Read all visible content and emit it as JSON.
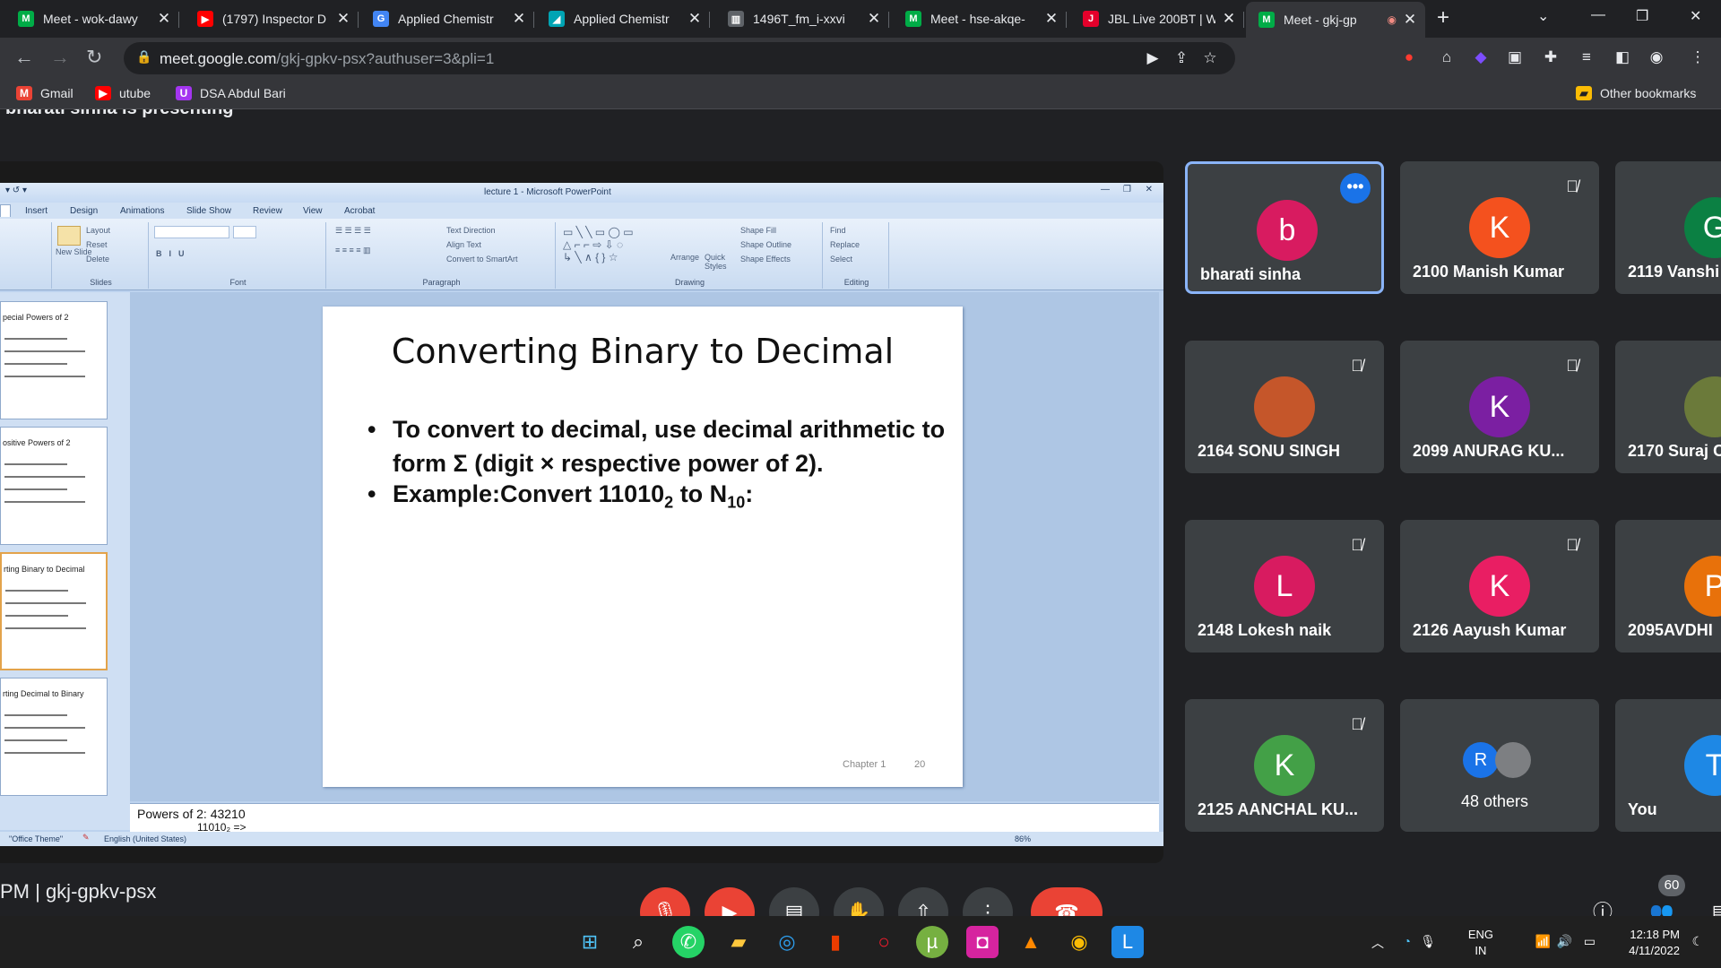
{
  "browser": {
    "tabs": [
      {
        "title": "Meet - wok-dawy",
        "fav_color": "#00ac47",
        "fav_glyph": "M",
        "active": false
      },
      {
        "title": "(1797) Inspector D",
        "fav_color": "#ff0000",
        "fav_glyph": "▶",
        "active": false
      },
      {
        "title": "Applied Chemistr",
        "fav_color": "#4285f4",
        "fav_glyph": "G",
        "active": false
      },
      {
        "title": "Applied Chemistr",
        "fav_color": "#00a4b4",
        "fav_glyph": "◢",
        "active": false
      },
      {
        "title": "1496T_fm_i-xxvi",
        "fav_color": "#5f6368",
        "fav_glyph": "▥",
        "active": false
      },
      {
        "title": "Meet - hse-akqe-",
        "fav_color": "#00ac47",
        "fav_glyph": "M",
        "active": false
      },
      {
        "title": "JBL Live 200BT | W",
        "fav_color": "#e4002b",
        "fav_glyph": "J",
        "active": false
      },
      {
        "title": "Meet - gkj-gp",
        "fav_color": "#00ac47",
        "fav_glyph": "M",
        "active": true
      }
    ],
    "url_host": "meet.google.com",
    "url_path": "/gkj-gpkv-psx?authuser=3&pli=1",
    "bookmarks": [
      {
        "label": "Gmail",
        "icon": "gmail-icon",
        "color": "#ea4335",
        "glyph": "M"
      },
      {
        "label": "utube",
        "icon": "youtube-icon",
        "color": "#ff0000",
        "glyph": "▶"
      },
      {
        "label": "DSA Abdul Bari",
        "icon": "udemy-icon",
        "color": "#a435f0",
        "glyph": "U"
      }
    ],
    "other_bookmarks": "Other bookmarks"
  },
  "meet": {
    "presenting_text": "bharati sinha is presenting",
    "participants": [
      {
        "name": "bharati sinha",
        "initial": "b",
        "color": "#d81b60",
        "muted": false,
        "active": true
      },
      {
        "name": "2100 Manish Kumar",
        "initial": "K",
        "color": "#f4511e",
        "muted": true
      },
      {
        "name": "2119 Vanshi",
        "initial": "G",
        "color": "#0b8043",
        "muted": false
      },
      {
        "name": "2164 SONU SINGH",
        "initial": "",
        "color": "#c5562a",
        "muted": true,
        "photo": true
      },
      {
        "name": "2099 ANURAG KU...",
        "initial": "K",
        "color": "#7b1fa2",
        "muted": true
      },
      {
        "name": "2170 Suraj C",
        "initial": "",
        "color": "#6b7a3a",
        "muted": false,
        "photo": true
      },
      {
        "name": "2148 Lokesh naik",
        "initial": "L",
        "color": "#d81b60",
        "muted": true
      },
      {
        "name": "2126 Aayush Kumar",
        "initial": "K",
        "color": "#e91e63",
        "muted": true
      },
      {
        "name": "2095AVDHI",
        "initial": "P",
        "color": "#e8710a",
        "muted": false
      },
      {
        "name": "2125 AANCHAL KU...",
        "initial": "K",
        "color": "#43a047",
        "muted": true
      },
      {
        "name": "48 others",
        "initial": "R",
        "color": "#1a73e8",
        "muted": false,
        "others": true
      },
      {
        "name": "You",
        "initial": "T",
        "color": "#1e88e5",
        "muted": false
      }
    ],
    "clock_text": "PM | gkj-gpkv-psx",
    "participant_count": "60"
  },
  "powerpoint": {
    "window_title": "lecture 1 - Microsoft PowerPoint",
    "tabs": [
      "Insert",
      "Design",
      "Animations",
      "Slide Show",
      "Review",
      "View",
      "Acrobat"
    ],
    "groups": [
      "Slides",
      "Font",
      "Paragraph",
      "Drawing",
      "Editing"
    ],
    "ribbon_items": {
      "layout": "Layout",
      "reset": "Reset",
      "delete": "Delete",
      "new_slide": "New Slide",
      "text_direction": "Text Direction",
      "align_text": "Align Text",
      "convert_smartart": "Convert to SmartArt",
      "arrange": "Arrange",
      "quick_styles": "Quick Styles",
      "shape_fill": "Shape Fill",
      "shape_outline": "Shape Outline",
      "shape_effects": "Shape Effects",
      "find": "Find",
      "replace": "Replace",
      "select": "Select"
    },
    "thumbs": [
      {
        "title": "pecial Powers of 2",
        "selected": false
      },
      {
        "title": "ositive Powers of 2",
        "selected": false
      },
      {
        "title": "rting Binary to Decimal",
        "selected": true
      },
      {
        "title": "rting Decimal to Binary",
        "selected": false
      }
    ],
    "slide": {
      "title": "Converting Binary to Decimal",
      "bullet1": "To convert to decimal, use decimal arithmetic to form Σ (digit × respective power of 2).",
      "bullet2_pre": "Example:Convert 11010",
      "bullet2_sub": "2",
      "bullet2_mid": " to N",
      "bullet2_sub2": "10",
      "bullet2_post": ":",
      "chapter": "Chapter 1",
      "page": "20"
    },
    "notes_line1": "Powers of 2:  43210",
    "notes_line2": "11010₂ =>",
    "status_theme": "\"Office Theme\"",
    "status_lang": "English (United States)",
    "zoom": "86%"
  },
  "taskbar": {
    "lang": "ENG",
    "region": "IN",
    "time": "12:18 PM",
    "date": "4/11/2022"
  }
}
